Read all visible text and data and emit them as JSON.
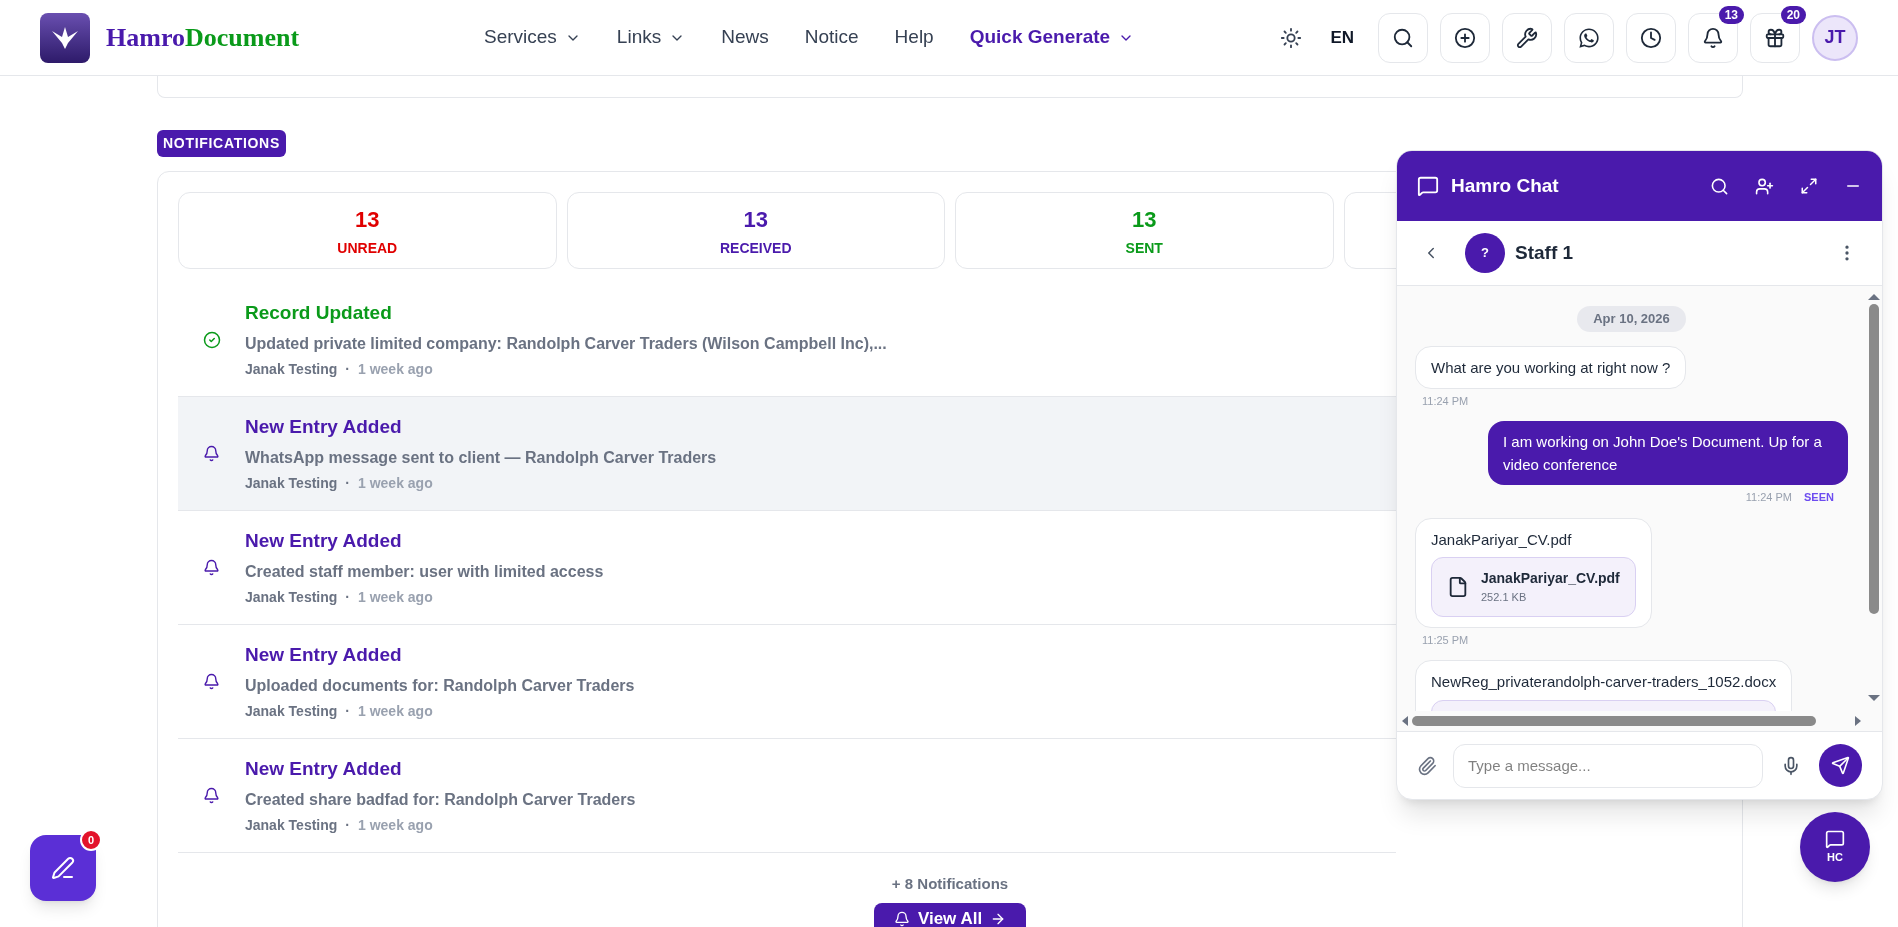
{
  "header": {
    "brand": {
      "part_1": "Hamro",
      "part_2": "Document"
    },
    "nav": [
      {
        "label": "Services",
        "dropdown": true,
        "highlighted": false
      },
      {
        "label": "Links",
        "dropdown": true,
        "highlighted": false
      },
      {
        "label": "News",
        "dropdown": false,
        "highlighted": false
      },
      {
        "label": "Notice",
        "dropdown": false,
        "highlighted": false
      },
      {
        "label": "Help",
        "dropdown": false,
        "highlighted": false
      },
      {
        "label": "Quick Generate",
        "dropdown": true,
        "highlighted": true
      }
    ],
    "language": "EN",
    "toolbar": [
      {
        "kind": "search"
      },
      {
        "kind": "add"
      },
      {
        "kind": "tools"
      },
      {
        "kind": "whatsapp"
      },
      {
        "kind": "history"
      },
      {
        "kind": "bell",
        "badge": "13"
      },
      {
        "kind": "gift",
        "badge": "20"
      }
    ],
    "avatar": "JT"
  },
  "notifications": {
    "title": "NOTIFICATIONS",
    "stats": [
      {
        "count": "13",
        "label": "UNREAD",
        "color": "#e00000"
      },
      {
        "count": "13",
        "label": "RECEIVED",
        "color": "#4a1aac"
      },
      {
        "count": "13",
        "label": "SENT",
        "color": "#0a9a1a"
      }
    ],
    "items": [
      {
        "kind": "updated",
        "title": "Record Updated",
        "message": "Updated private limited company: Randolph Carver Traders (Wilson Campbell Inc),...",
        "author": "Janak Testing",
        "separator": "·",
        "time": "1 week ago",
        "selected": false
      },
      {
        "kind": "entry",
        "title": "New Entry Added",
        "message": "WhatsApp message sent to client — Randolph Carver Traders",
        "author": "Janak Testing",
        "separator": "·",
        "time": "1 week ago",
        "selected": true
      },
      {
        "kind": "entry",
        "title": "New Entry Added",
        "message": "Created staff member: user with limited access",
        "author": "Janak Testing",
        "separator": "·",
        "time": "1 week ago",
        "selected": false
      },
      {
        "kind": "entry",
        "title": "New Entry Added",
        "message": "Uploaded documents for: Randolph Carver Traders",
        "author": "Janak Testing",
        "separator": "·",
        "time": "1 week ago",
        "selected": false
      },
      {
        "kind": "entry",
        "title": "New Entry Added",
        "message": "Created share badfad for: Randolph Carver Traders",
        "author": "Janak Testing",
        "separator": "·",
        "time": "1 week ago",
        "selected": false
      }
    ],
    "more": "+ 8 Notifications",
    "view_all": "View All"
  },
  "edit_button": {
    "badge": "0"
  },
  "chat": {
    "title": "Hamro Chat",
    "contact": {
      "initial": "?",
      "name": "Staff 1"
    },
    "messages": [
      {
        "kind": "date",
        "text": "Apr 10, 2026"
      },
      {
        "kind": "incoming_text",
        "text": "What are you working at right now ?",
        "time": "11:24 PM"
      },
      {
        "kind": "outgoing_text",
        "text": "I am working on John Doe's Document. Up for a video conference",
        "time": "11:24 PM",
        "status": "SEEN"
      },
      {
        "kind": "incoming_file",
        "caption": "JanakPariyar_CV.pdf",
        "file_name": "JanakPariyar_CV.pdf",
        "file_size": "252.1 KB",
        "time": "11:25 PM"
      },
      {
        "kind": "incoming_file",
        "caption": "NewReg_privaterandolph-carver-traders_1052.docx"
      }
    ],
    "input": {
      "placeholder": "Type a message..."
    },
    "launcher": "HC"
  }
}
